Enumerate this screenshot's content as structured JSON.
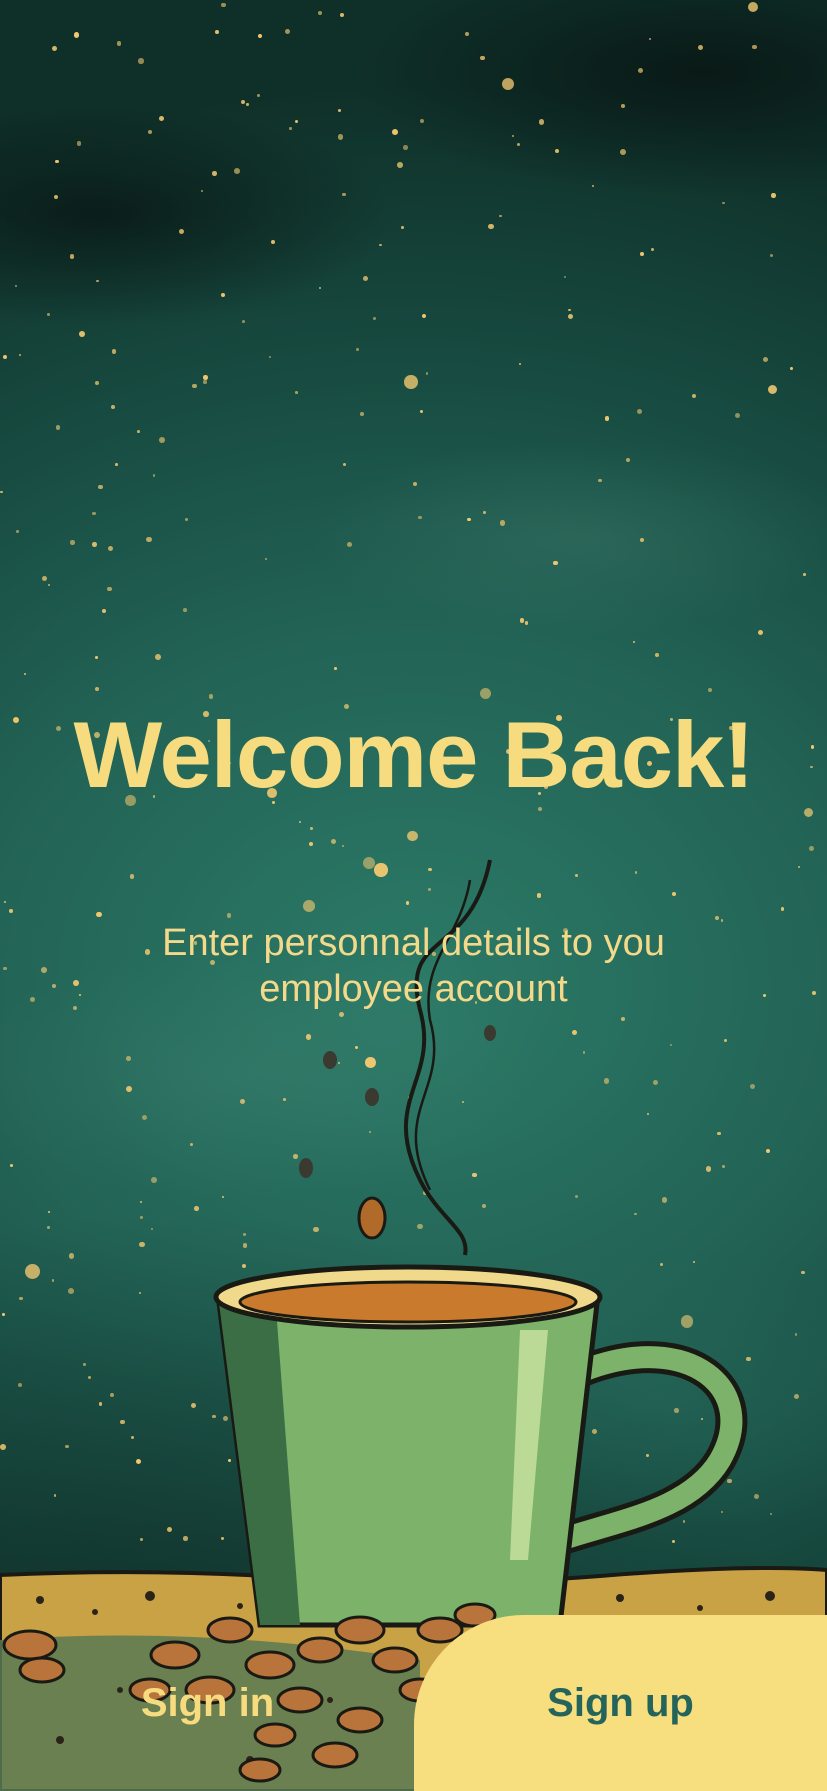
{
  "welcome": {
    "title": "Welcome Back!",
    "subtitle": "Enter personnal details to you employee account"
  },
  "actions": {
    "sign_in": "Sign in",
    "sign_up": "Sign up"
  },
  "colors": {
    "background": "#226355",
    "accent_yellow": "#f7df80",
    "button_text_teal": "#24645a"
  }
}
